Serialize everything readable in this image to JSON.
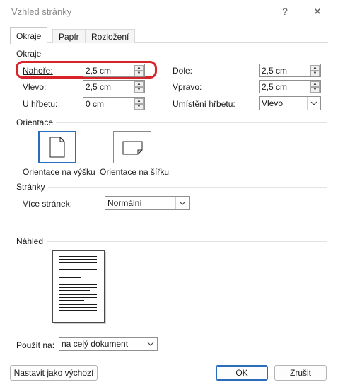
{
  "window": {
    "title": "Vzhled stránky",
    "help": "?",
    "close": "✕"
  },
  "tabs": [
    {
      "label": "Okraje",
      "active": true
    },
    {
      "label": "Papír",
      "active": false
    },
    {
      "label": "Rozložení",
      "active": false
    }
  ],
  "margins": {
    "group": "Okraje",
    "top": {
      "label": "Nahoře:",
      "value": "2,5 cm"
    },
    "bottom": {
      "label": "Dole:",
      "value": "2,5 cm"
    },
    "left": {
      "label": "Vlevo:",
      "value": "2,5 cm"
    },
    "right": {
      "label": "Vpravo:",
      "value": "2,5 cm"
    },
    "gutter": {
      "label": "U hřbetu:",
      "value": "0 cm"
    },
    "gutter_pos": {
      "label": "Umístění hřbetu:",
      "value": "Vlevo"
    }
  },
  "orientation": {
    "group": "Orientace",
    "portrait": "Orientace na výšku",
    "landscape": "Orientace na šířku",
    "selected": "portrait"
  },
  "pages": {
    "group": "Stránky",
    "multiple": {
      "label": "Více stránek:",
      "value": "Normální"
    }
  },
  "preview": {
    "group": "Náhled",
    "apply": {
      "label": "Použít na:",
      "value": "na celý dokument"
    }
  },
  "buttons": {
    "default": "Nastavit jako výchozí",
    "ok": "OK",
    "cancel": "Zrušit"
  },
  "colors": {
    "accent": "#2a6ebb",
    "highlight": "#d8232a"
  }
}
